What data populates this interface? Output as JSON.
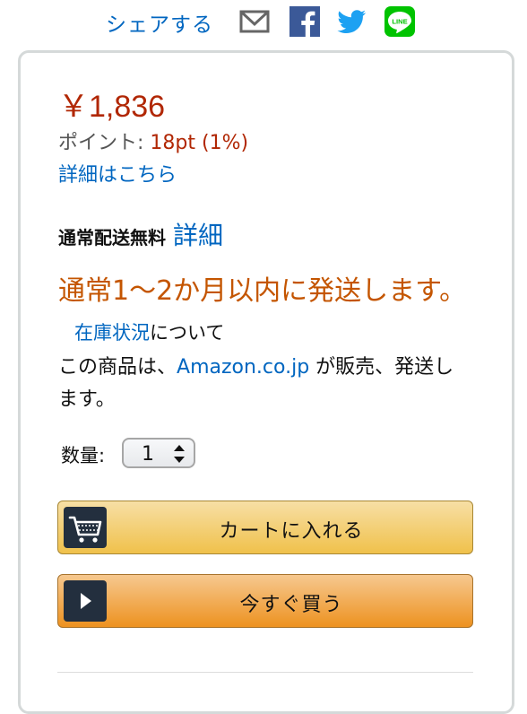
{
  "share": {
    "label": "シェアする",
    "icons": [
      "mail-icon",
      "facebook-icon",
      "twitter-icon",
      "line-icon"
    ],
    "line_text": "LINE"
  },
  "buybox": {
    "price": "￥1,836",
    "points_label": "ポイント:",
    "points_value": "18pt (1%)",
    "details_link": "詳細はこちら",
    "shipping_label": "通常配送無料",
    "shipping_detail": "詳細",
    "availability": "通常1～2か月以内に発送します。",
    "availability_link": "在庫状況",
    "availability_tail": "について",
    "seller_prefix": "この商品は、",
    "seller_link": "Amazon.co.jp",
    "seller_suffix": "が販売、発送します。",
    "quantity_label": "数量:",
    "quantity_value": "1",
    "add_to_cart": "カートに入れる",
    "buy_now": "今すぐ買う"
  },
  "colors": {
    "price": "#b12704",
    "link": "#0066c0",
    "availability": "#c45500",
    "cart_button": "#f0c14b",
    "buy_button": "#ed9220",
    "facebook": "#3b5998",
    "twitter": "#1da1f2",
    "line": "#00c300"
  }
}
